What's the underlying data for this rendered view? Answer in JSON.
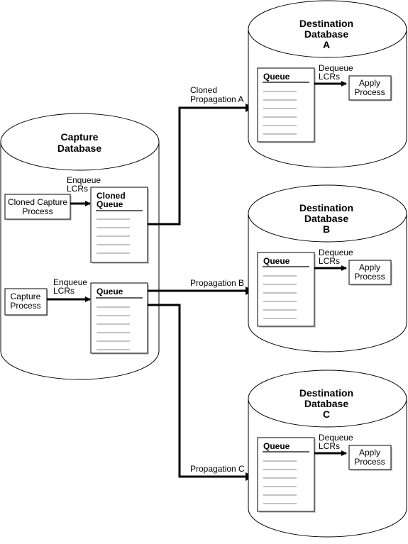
{
  "capture_db": {
    "title": [
      "Capture",
      "Database"
    ],
    "cloned_capture_process": [
      "Cloned Capture",
      "Process"
    ],
    "capture_process": [
      "Capture",
      "Process"
    ],
    "enqueue_label": [
      "Enqueue",
      "LCRs"
    ],
    "cloned_queue": [
      "Cloned",
      "Queue"
    ],
    "queue": "Queue"
  },
  "propagations": {
    "a": [
      "Cloned",
      "Propagation A"
    ],
    "b": "Propagation B",
    "c": "Propagation C"
  },
  "destinations": [
    {
      "title": [
        "Destination",
        "Database",
        "A"
      ],
      "queue": "Queue",
      "dequeue": [
        "Dequeue",
        "LCRs"
      ],
      "apply": [
        "Apply",
        "Process"
      ]
    },
    {
      "title": [
        "Destination",
        "Database",
        "B"
      ],
      "queue": "Queue",
      "dequeue": [
        "Dequeue",
        "LCRs"
      ],
      "apply": [
        "Apply",
        "Process"
      ]
    },
    {
      "title": [
        "Destination",
        "Database",
        "C"
      ],
      "queue": "Queue",
      "dequeue": [
        "Dequeue",
        "LCRs"
      ],
      "apply": [
        "Apply",
        "Process"
      ]
    }
  ]
}
